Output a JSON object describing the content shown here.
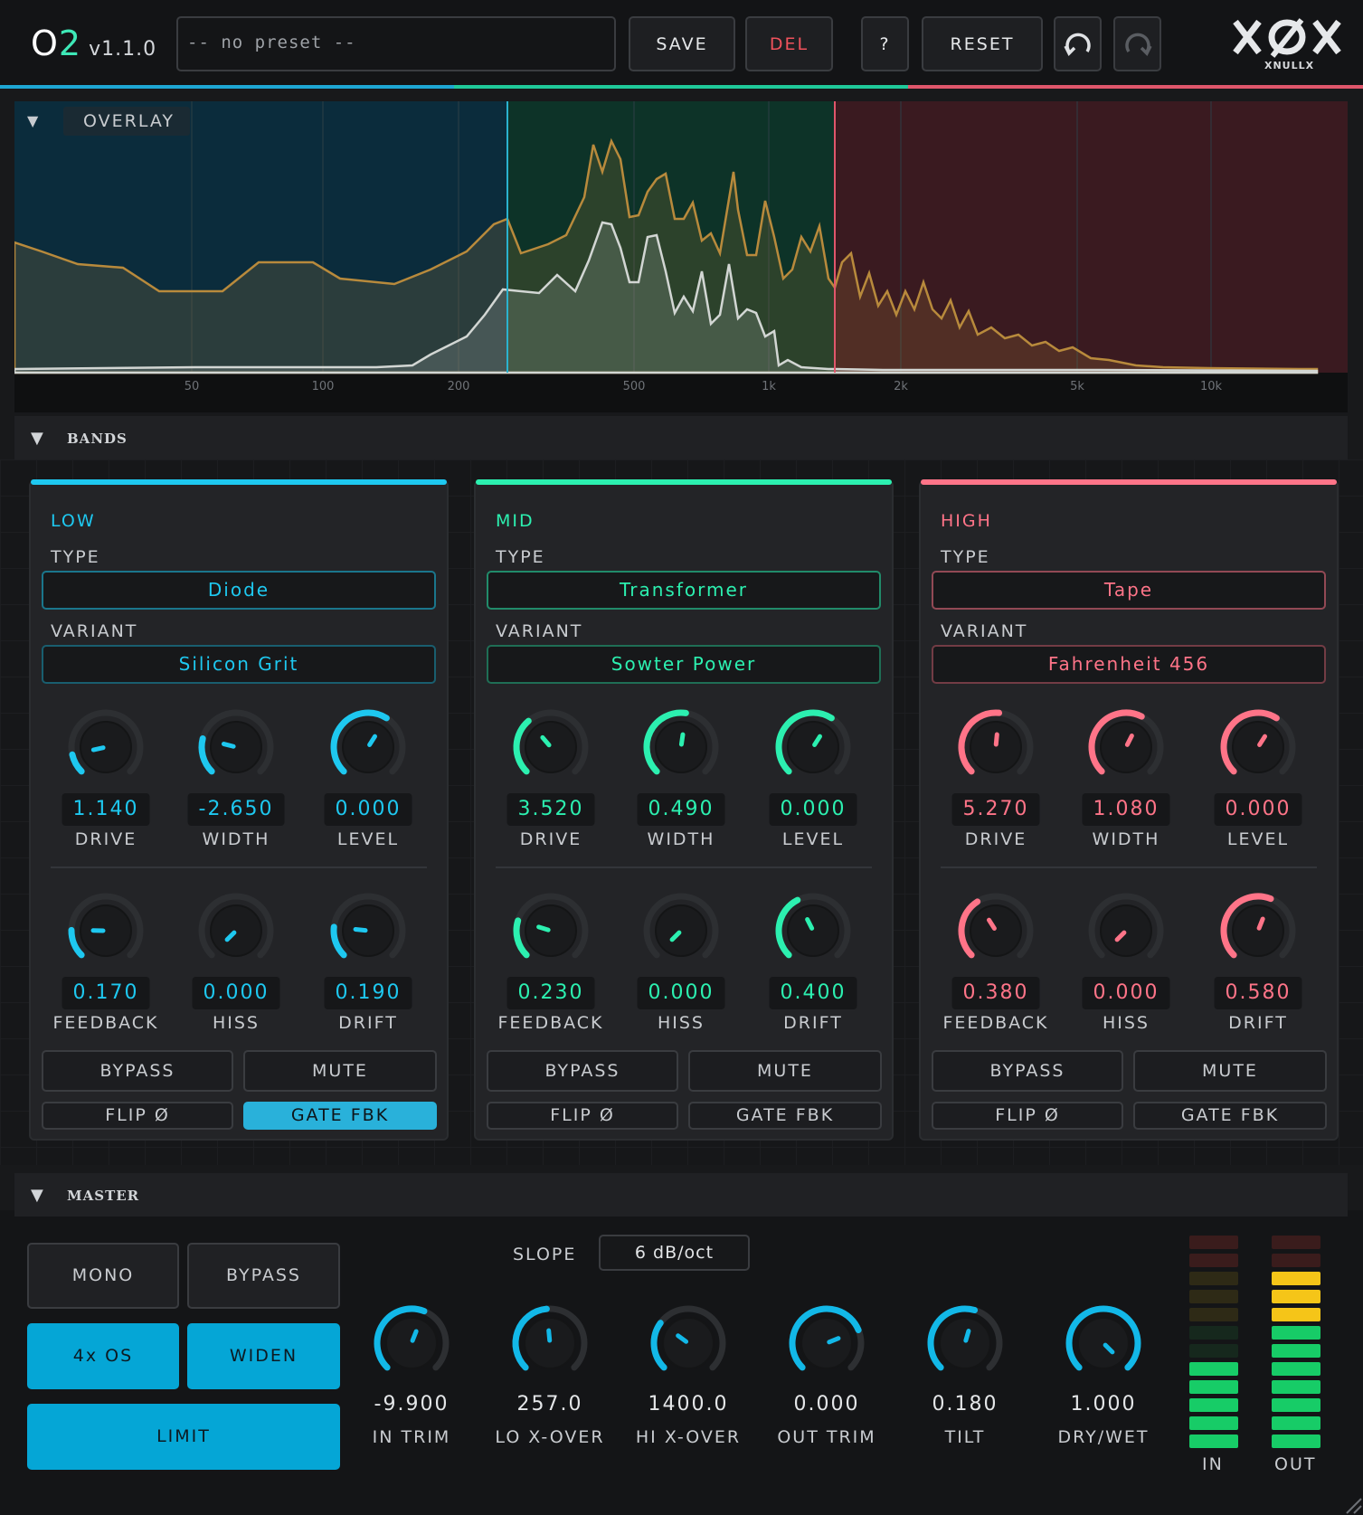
{
  "app": {
    "name_prefix": "O",
    "name_suffix": "2",
    "version": "v1.1.0",
    "brand": "XNULLX"
  },
  "colors": {
    "low": "#1ec8f0",
    "mid": "#2cf0b0",
    "high": "#ff7488",
    "meter_on": "#17cc67",
    "meter_warn": "#f5c518"
  },
  "header": {
    "preset": "-- no preset --",
    "save": "SAVE",
    "del": "DEL",
    "help": "?",
    "reset": "RESET",
    "undo_icon": "undo-icon",
    "redo_icon": "redo-icon"
  },
  "overlay": {
    "label": "OVERLAY",
    "freq_labels": [
      "50",
      "100",
      "200",
      "500",
      "1k",
      "2k",
      "5k",
      "10k"
    ]
  },
  "bands_section": {
    "title": "BANDS"
  },
  "bands": [
    {
      "id": "low",
      "name": "LOW",
      "type_label": "TYPE",
      "type": "Diode",
      "variant_label": "VARIANT",
      "variant": "Silicon Grit",
      "knobs": [
        {
          "name": "DRIVE",
          "value": "1.140",
          "norm": 0.12
        },
        {
          "name": "WIDTH",
          "value": "-2.650",
          "norm": 0.22
        },
        {
          "name": "LEVEL",
          "value": "0.000",
          "norm": 0.62
        },
        {
          "name": "FEEDBACK",
          "value": "0.170",
          "norm": 0.17
        },
        {
          "name": "HISS",
          "value": "0.000",
          "norm": 0.0
        },
        {
          "name": "DRIFT",
          "value": "0.190",
          "norm": 0.19
        }
      ],
      "bypass": "BYPASS",
      "mute": "MUTE",
      "flip": "FLIP Ø",
      "gate": "GATE FBK",
      "gate_on": true
    },
    {
      "id": "mid",
      "name": "MID",
      "type_label": "TYPE",
      "type": "Transformer",
      "variant_label": "VARIANT",
      "variant": "Sowter Power",
      "knobs": [
        {
          "name": "DRIVE",
          "value": "3.520",
          "norm": 0.35
        },
        {
          "name": "WIDTH",
          "value": "0.490",
          "norm": 0.53
        },
        {
          "name": "LEVEL",
          "value": "0.000",
          "norm": 0.62
        },
        {
          "name": "FEEDBACK",
          "value": "0.230",
          "norm": 0.23
        },
        {
          "name": "HISS",
          "value": "0.000",
          "norm": 0.0
        },
        {
          "name": "DRIFT",
          "value": "0.400",
          "norm": 0.4
        }
      ],
      "bypass": "BYPASS",
      "mute": "MUTE",
      "flip": "FLIP Ø",
      "gate": "GATE FBK",
      "gate_on": false
    },
    {
      "id": "high",
      "name": "HIGH",
      "type_label": "TYPE",
      "type": "Tape",
      "variant_label": "VARIANT",
      "variant": "Fahrenheit 456",
      "knobs": [
        {
          "name": "DRIVE",
          "value": "5.270",
          "norm": 0.52
        },
        {
          "name": "WIDTH",
          "value": "1.080",
          "norm": 0.6
        },
        {
          "name": "LEVEL",
          "value": "0.000",
          "norm": 0.62
        },
        {
          "name": "FEEDBACK",
          "value": "0.380",
          "norm": 0.38
        },
        {
          "name": "HISS",
          "value": "0.000",
          "norm": 0.0
        },
        {
          "name": "DRIFT",
          "value": "0.580",
          "norm": 0.58
        }
      ],
      "bypass": "BYPASS",
      "mute": "MUTE",
      "flip": "FLIP Ø",
      "gate": "GATE FBK",
      "gate_on": false
    }
  ],
  "master": {
    "title": "MASTER",
    "mono": "MONO",
    "bypass": "BYPASS",
    "os": "4x OS",
    "widen": "WIDEN",
    "limit": "LIMIT",
    "slope_label": "SLOPE",
    "slope": "6 dB/oct",
    "knobs": [
      {
        "name": "IN TRIM",
        "value": "-9.900",
        "norm": 0.58
      },
      {
        "name": "LO X-OVER",
        "value": "257.0",
        "norm": 0.48
      },
      {
        "name": "HI X-OVER",
        "value": "1400.0",
        "norm": 0.3
      },
      {
        "name": "OUT TRIM",
        "value": "0.000",
        "norm": 0.75
      },
      {
        "name": "TILT",
        "value": "0.180",
        "norm": 0.56
      },
      {
        "name": "DRY/WET",
        "value": "1.000",
        "norm": 1.0
      }
    ],
    "meter_in_label": "IN",
    "meter_out_label": "OUT",
    "meter_in_level": 0.45,
    "meter_out_level": 0.8
  }
}
